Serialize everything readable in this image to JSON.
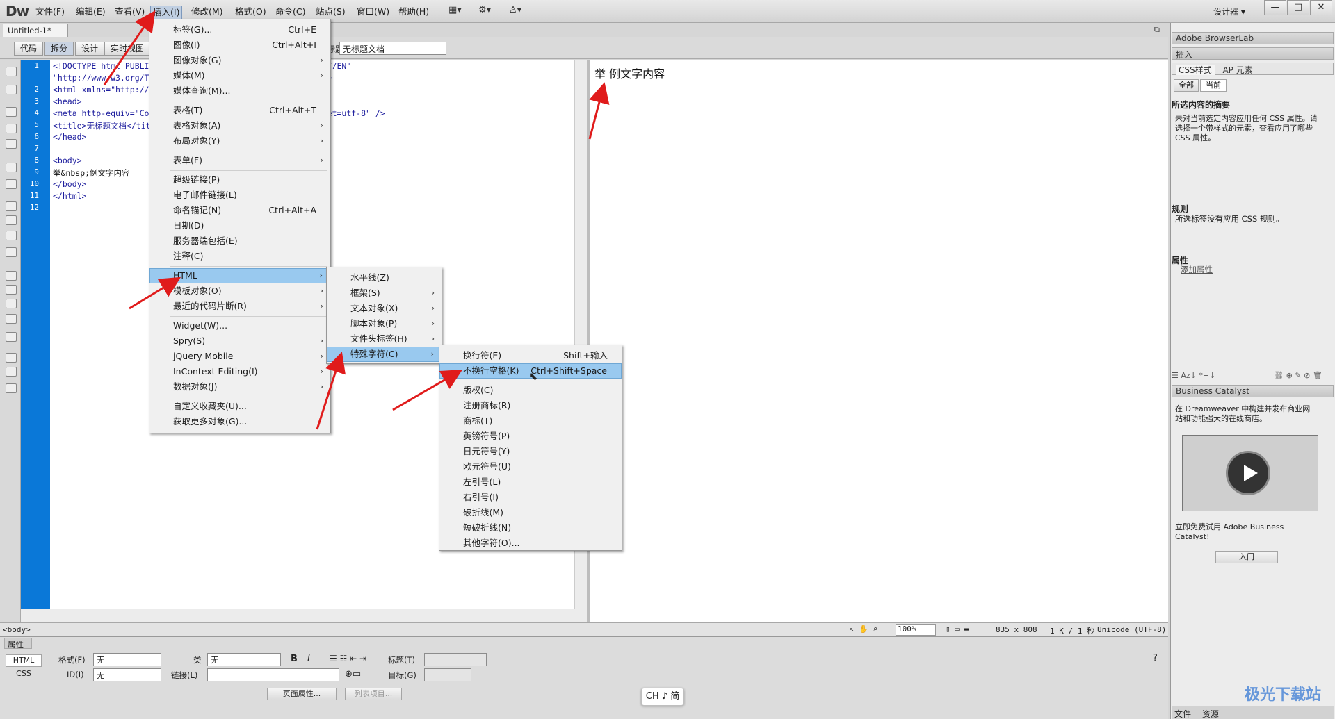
{
  "app": {
    "logo": "Dw",
    "mode_label": "设计器 ▾"
  },
  "menubar": [
    "文件(F)",
    "编辑(E)",
    "查看(V)",
    "插入(I)",
    "修改(M)",
    "格式(O)",
    "命令(C)",
    "站点(S)",
    "窗口(W)",
    "帮助(H)"
  ],
  "doc": {
    "tab_label": "Untitled-1*",
    "close": "×",
    "title_label": "标题:",
    "title_value": "无标题文档"
  },
  "views": [
    "代码",
    "拆分",
    "设计",
    "实时视图"
  ],
  "code": {
    "line_numbers": [
      "1",
      "",
      "2",
      "3",
      "4",
      "5",
      "6",
      "7",
      "8",
      "9",
      "10",
      "11",
      "12"
    ],
    "lines": [
      "<!DOCTYPE html PUBLIC \"-//W3C//DTD XHTML 1.0 Transitional//EN\"",
      "\"http://www.w3.org/TR/xhtml1/DTD/xhtml1-transitional.dtd\">",
      "<html xmlns=\"http://www.w3.org/1999/xhtml\">",
      "<head>",
      "<meta http-equiv=\"Content-Type\" content=\"text/html; charset=utf-8\" />",
      "<title>无标题文档</title>",
      "</head>",
      "",
      "<body>",
      "举&nbsp;例文字内容",
      "</body>",
      "</html>",
      ""
    ]
  },
  "design_text": "举 例文字内容",
  "insert_menu": [
    {
      "label": "标签(G)...",
      "shortcut": "Ctrl+E"
    },
    {
      "label": "图像(I)",
      "shortcut": "Ctrl+Alt+I"
    },
    {
      "label": "图像对象(G)",
      "sub": true
    },
    {
      "label": "媒体(M)",
      "sub": true
    },
    {
      "label": "媒体查询(M)..."
    },
    {
      "sep": true
    },
    {
      "label": "表格(T)",
      "shortcut": "Ctrl+Alt+T"
    },
    {
      "label": "表格对象(A)",
      "sub": true
    },
    {
      "label": "布局对象(Y)",
      "sub": true
    },
    {
      "sep": true
    },
    {
      "label": "表单(F)",
      "sub": true
    },
    {
      "sep": true
    },
    {
      "label": "超级链接(P)"
    },
    {
      "label": "电子邮件链接(L)"
    },
    {
      "label": "命名锚记(N)",
      "shortcut": "Ctrl+Alt+A"
    },
    {
      "label": "日期(D)"
    },
    {
      "label": "服务器端包括(E)"
    },
    {
      "label": "注释(C)"
    },
    {
      "sep": true
    },
    {
      "label": "HTML",
      "sub": true,
      "hl": true
    },
    {
      "label": "模板对象(O)",
      "sub": true
    },
    {
      "label": "最近的代码片断(R)",
      "sub": true
    },
    {
      "sep": true
    },
    {
      "label": "Widget(W)..."
    },
    {
      "label": "Spry(S)",
      "sub": true
    },
    {
      "label": "jQuery Mobile",
      "sub": true
    },
    {
      "label": "InContext Editing(I)",
      "sub": true
    },
    {
      "label": "数据对象(J)",
      "sub": true
    },
    {
      "sep": true
    },
    {
      "label": "自定义收藏夹(U)..."
    },
    {
      "label": "获取更多对象(G)..."
    }
  ],
  "html_menu": [
    {
      "label": "水平线(Z)"
    },
    {
      "label": "框架(S)",
      "sub": true
    },
    {
      "label": "文本对象(X)",
      "sub": true
    },
    {
      "label": "脚本对象(P)",
      "sub": true
    },
    {
      "label": "文件头标签(H)",
      "sub": true
    },
    {
      "label": "特殊字符(C)",
      "sub": true,
      "hl": true
    }
  ],
  "special_menu": [
    {
      "label": "换行符(E)",
      "shortcut": "Shift+输入"
    },
    {
      "label": "不换行空格(K)",
      "shortcut": "Ctrl+Shift+Space",
      "hl": true
    },
    {
      "sep": true
    },
    {
      "label": "版权(C)"
    },
    {
      "label": "注册商标(R)"
    },
    {
      "label": "商标(T)"
    },
    {
      "label": "英镑符号(P)"
    },
    {
      "label": "日元符号(Y)"
    },
    {
      "label": "欧元符号(U)"
    },
    {
      "label": "左引号(L)"
    },
    {
      "label": "右引号(I)"
    },
    {
      "label": "破折线(M)"
    },
    {
      "label": "短破折线(N)"
    },
    {
      "label": "其他字符(O)..."
    }
  ],
  "status": {
    "tag": "<body>",
    "zoom": "100%",
    "size": "835 x 808",
    "file": "1 K / 1 秒",
    "encoding": "Unicode (UTF-8)"
  },
  "properties": {
    "title": "属性",
    "html_btn": "HTML",
    "css_btn": "CSS",
    "format_label": "格式(F)",
    "format_value": "无",
    "id_label": "ID(I)",
    "id_value": "无",
    "class_label": "类",
    "class_value": "无",
    "link_label": "链接(L)",
    "heading_label": "标题(T)",
    "target_label": "目标(G)",
    "page_props": "页面属性...",
    "list_item": "列表项目..."
  },
  "right_panel": {
    "browserlab": "Adobe BrowserLab",
    "insert": "插入",
    "css_tab": "CSS样式",
    "ap_tab": "AP 元素",
    "all": "全部",
    "current": "当前",
    "summary_title": "所选内容的摘要",
    "summary_text": "未对当前选定内容应用任何 CSS 属性。请选择一个带样式的元素，查看应用了哪些 CSS 属性。",
    "rules_title": "规则",
    "rules_text": "所选标签没有应用 CSS 规则。",
    "props_title": "属性",
    "add_prop": "添加属性",
    "bc_title": "Business Catalyst",
    "bc_text": "在 Dreamweaver 中构建并发布商业网站和功能强大的在线商店。",
    "bc_try": "立即免费试用 Adobe Business Catalyst!",
    "bc_btn": "入门",
    "bottom_tabs": [
      "文件",
      "资源"
    ]
  },
  "ime": "CH ♪ 简",
  "watermark": "极光下载站"
}
